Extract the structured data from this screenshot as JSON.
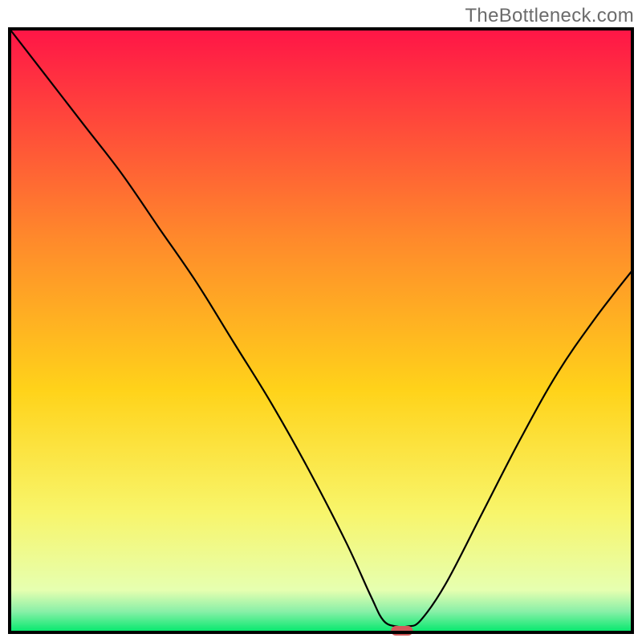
{
  "watermark": "TheBottleneck.com",
  "colors": {
    "gradient_top": "#ff1547",
    "gradient_mid1": "#ff8a2b",
    "gradient_mid2": "#ffd31a",
    "gradient_mid3": "#f8f56a",
    "gradient_bottom_band": "#e6ffb0",
    "gradient_green": "#00e86b",
    "curve": "#000000",
    "marker": "#d25a5a",
    "frame": "#000000"
  },
  "chart_data": {
    "type": "line",
    "title": "",
    "xlabel": "",
    "ylabel": "",
    "xlim": [
      0,
      100
    ],
    "ylim": [
      0,
      100
    ],
    "grid": false,
    "legend": null,
    "annotations": [],
    "background_gradient_stops": [
      {
        "offset": 0.0,
        "color": "#ff1547"
      },
      {
        "offset": 0.35,
        "color": "#ff8a2b"
      },
      {
        "offset": 0.6,
        "color": "#ffd31a"
      },
      {
        "offset": 0.8,
        "color": "#f8f56a"
      },
      {
        "offset": 0.93,
        "color": "#e6ffb0"
      },
      {
        "offset": 0.965,
        "color": "#8af0a8"
      },
      {
        "offset": 1.0,
        "color": "#00e86b"
      }
    ],
    "series": [
      {
        "name": "bottleneck-curve",
        "x": [
          0,
          6,
          12,
          18,
          24,
          30,
          36,
          42,
          48,
          54,
          58,
          60,
          62,
          64,
          66,
          70,
          76,
          82,
          88,
          94,
          100
        ],
        "y": [
          100,
          92,
          84,
          76,
          67,
          58,
          48,
          38,
          27,
          15,
          6,
          2,
          1,
          1,
          2,
          8,
          20,
          32,
          43,
          52,
          60
        ]
      }
    ],
    "marker": {
      "name": "optimal-point",
      "x": 63,
      "y": 0,
      "width_pct": 3.5,
      "height_pct": 1.6
    }
  }
}
